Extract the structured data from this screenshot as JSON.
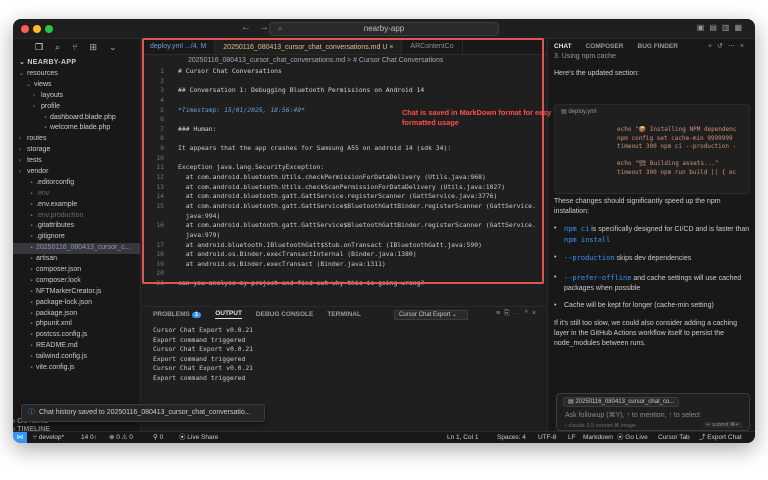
{
  "window": {
    "search": "nearby-app",
    "colors": {
      "close": "#ff5f57",
      "minimize": "#febc2e",
      "maximize": "#28c840",
      "accent": "#3794ff",
      "annotation": "#e05454"
    }
  },
  "explorer": {
    "project": "NEARBY-APP",
    "items": [
      {
        "label": "resources",
        "indent": 0,
        "type": "folder-open"
      },
      {
        "label": "views",
        "indent": 1,
        "type": "folder-open"
      },
      {
        "label": "layouts",
        "indent": 2,
        "type": "folder"
      },
      {
        "label": "profile",
        "indent": 2,
        "type": "folder"
      },
      {
        "label": "dashboard.blade.php",
        "indent": 2,
        "type": "file"
      },
      {
        "label": "welcome.blade.php",
        "indent": 2,
        "type": "file"
      },
      {
        "label": "routes",
        "indent": 0,
        "type": "folder"
      },
      {
        "label": "storage",
        "indent": 0,
        "type": "folder"
      },
      {
        "label": "tests",
        "indent": 0,
        "type": "folder"
      },
      {
        "label": "vendor",
        "indent": 0,
        "type": "folder"
      },
      {
        "label": ".editorconfig",
        "indent": 0,
        "type": "file"
      },
      {
        "label": ".env",
        "indent": 0,
        "type": "file-dim"
      },
      {
        "label": ".env.example",
        "indent": 0,
        "type": "file"
      },
      {
        "label": ".env.production",
        "indent": 0,
        "type": "file-dim"
      },
      {
        "label": ".gitattributes",
        "indent": 0,
        "type": "file"
      },
      {
        "label": ".gitignore",
        "indent": 0,
        "type": "file"
      },
      {
        "label": "20250116_080413_cursor_c...",
        "indent": 0,
        "type": "file-active"
      },
      {
        "label": "artisan",
        "indent": 0,
        "type": "file"
      },
      {
        "label": "composer.json",
        "indent": 0,
        "type": "file"
      },
      {
        "label": "composer.lock",
        "indent": 0,
        "type": "file"
      },
      {
        "label": "NFTMarkerCreator.js",
        "indent": 0,
        "type": "file"
      },
      {
        "label": "package-lock.json",
        "indent": 0,
        "type": "file"
      },
      {
        "label": "package.json",
        "indent": 0,
        "type": "file"
      },
      {
        "label": "phpunit.xml",
        "indent": 0,
        "type": "file"
      },
      {
        "label": "postcss.config.js",
        "indent": 0,
        "type": "file"
      },
      {
        "label": "README.md",
        "indent": 0,
        "type": "file"
      },
      {
        "label": "tailwind.config.js",
        "indent": 0,
        "type": "file"
      },
      {
        "label": "vite.config.js",
        "indent": 0,
        "type": "file"
      }
    ],
    "bottom": [
      "OUTLINE",
      "TIMELINE"
    ]
  },
  "tabs": [
    {
      "label": "deploy.yml .../4, M"
    },
    {
      "label": "20250116_080413_cursor_chat_conversations.md U"
    },
    {
      "label": "ARContentCo"
    }
  ],
  "breadcrumb": "20250116_080413_cursor_chat_conversations.md > # Cursor Chat Conversations",
  "editor": {
    "lines": [
      {
        "n": "1",
        "t": "# Cursor Chat Conversations",
        "k": "h"
      },
      {
        "n": "2",
        "t": "",
        "k": ""
      },
      {
        "n": "3",
        "t": "## Conversation 1: Debugging Bluetooth Permissions on Android 14",
        "k": "h"
      },
      {
        "n": "4",
        "t": "",
        "k": ""
      },
      {
        "n": "5",
        "t": "*Timestamp: 15/01/2025, 18:56:49*",
        "k": "ts"
      },
      {
        "n": "6",
        "t": "",
        "k": ""
      },
      {
        "n": "7",
        "t": "### Human:",
        "k": "h"
      },
      {
        "n": "8",
        "t": "",
        "k": ""
      },
      {
        "n": "9",
        "t": "It appears that the app crashes for Samsung A55 on android 14 (sdk 34):",
        "k": ""
      },
      {
        "n": "10",
        "t": "",
        "k": ""
      },
      {
        "n": "11",
        "t": "Exception java.lang.SecurityException:",
        "k": ""
      },
      {
        "n": "12",
        "t": "  at com.android.bluetooth.Utils.checkPermissionForDataDelivery (Utils.java:968)",
        "k": ""
      },
      {
        "n": "13",
        "t": "  at com.android.bluetooth.Utils.checkScanPermissionForDataDelivery (Utils.java:1027)",
        "k": ""
      },
      {
        "n": "14",
        "t": "  at com.android.bluetooth.gatt.GattService.registerScanner (GattService.java:3776)",
        "k": ""
      },
      {
        "n": "15",
        "t": "  at com.android.bluetooth.gatt.GattService$BluetoothGattBinder.registerScanner (GattService.",
        "k": ""
      },
      {
        "n": "",
        "t": "  java:994)",
        "k": ""
      },
      {
        "n": "16",
        "t": "  at com.android.bluetooth.gatt.GattService$BluetoothGattBinder.registerScanner (GattService.",
        "k": ""
      },
      {
        "n": "",
        "t": "  java:979)",
        "k": ""
      },
      {
        "n": "17",
        "t": "  at android.bluetooth.IBluetoothGatt$Stub.onTransact (IBluetoothGatt.java:590)",
        "k": ""
      },
      {
        "n": "18",
        "t": "  at android.os.Binder.execTransactInternal (Binder.java:1380)",
        "k": ""
      },
      {
        "n": "19",
        "t": "  at android.os.Binder.execTransact (Binder.java:1311)",
        "k": ""
      },
      {
        "n": "20",
        "t": "",
        "k": ""
      },
      {
        "n": "21",
        "t": "can you analyse my project and find out why this is going wrong?",
        "k": ""
      }
    ]
  },
  "annotation": "Chat is saved in MarkDown format for easy formatted usage",
  "panel": {
    "tabs": [
      "PROBLEMS",
      "OUTPUT",
      "DEBUG CONSOLE",
      "TERMINAL"
    ],
    "problems_count": "1",
    "selector": "Cursor Chat Export",
    "lines": [
      "Cursor Chat Export v0.0.21",
      "Export command triggered",
      "Cursor Chat Export v0.0.21",
      "Export command triggered",
      "Cursor Chat Export v0.0.21",
      "Export command triggered"
    ]
  },
  "chat": {
    "tabs": [
      "CHAT",
      "COMPOSER",
      "BUG FINDER"
    ],
    "top_cut": "3. Using npm cache",
    "intro": "Here's the updated section:",
    "card_file": "deploy.yml",
    "card_lines": [
      "echo \"📦 Installing NPM dependenc",
      "npm config set cache-min 9999999",
      "timeout 300 npm ci --production -",
      "",
      "echo \"🏗 Building assets...\"",
      "timeout 300 npm run build || { ec"
    ],
    "p1": "These changes should significantly speed up the npm installation:",
    "b1_code": "npm ci",
    "b1_text": " is specifically designed for CI/CD and is faster than ",
    "b1_code2": "npm install",
    "b2_code": "--production",
    "b2_text": " skips dev dependencies",
    "b3_code": "--prefer-offline",
    "b3_text": " and cache settings will use cached packages when possible",
    "b4": "Cache will be kept for longer (cache-min setting)",
    "p2": "If it's still too slow, we could also consider adding a caching layer in the GitHub Actions workflow itself to persist the node_modules between runs.",
    "input_chip": "20250116_080413_cursor_chat_co...",
    "input_placeholder": "Ask followup (⌘Y), ↑ to mention, ↑ to select",
    "model": "› claude-3.5-sonnet ⌘ image",
    "send": "↵ submit ⌘↵"
  },
  "toast": "Chat history saved to 20250116_080413_cursor_chat_conversatio...",
  "status": {
    "branch": "develop*",
    "sync": "14 0↑",
    "errors": "⊗ 0 ⚠ 0",
    "ports": "⚲ 0",
    "live": "⦿ Live Share",
    "position": "Ln 1, Col 1",
    "spaces": "Spaces: 4",
    "encoding": "UTF-8",
    "eol": "LF",
    "language": "Markdown",
    "golive": "⦿ Go Live",
    "cursor_tab": "Cursor Tab",
    "export": "⤴ Export Chat"
  }
}
